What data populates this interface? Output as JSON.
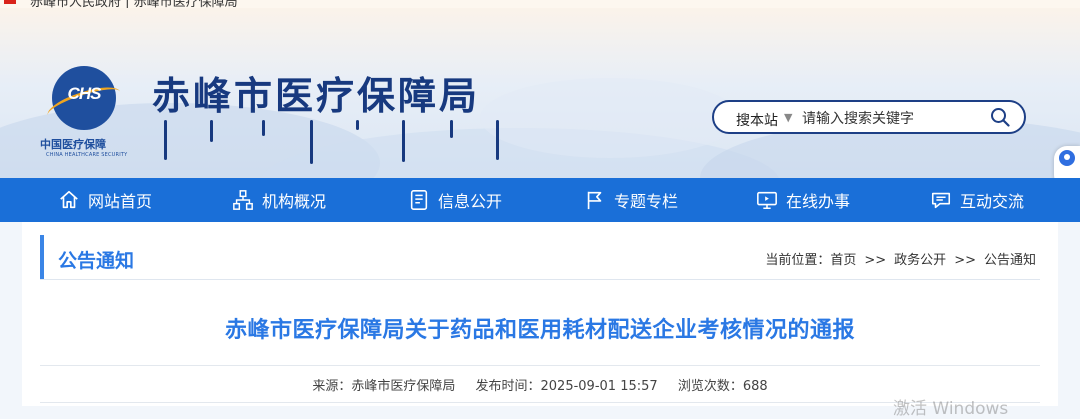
{
  "topbar": {
    "text": "赤峰市人民政府 | 赤峰市医疗保障局"
  },
  "header": {
    "logo": {
      "mark": "CHS",
      "cn": "中国医疗保障",
      "en": "CHINA HEALTHCARE SECURITY"
    },
    "site_title": "赤峰市医疗保障局",
    "search": {
      "scope": "搜本站",
      "placeholder": "请输入搜索关键字"
    }
  },
  "nav": {
    "items": [
      {
        "label": "网站首页",
        "icon": "home-icon"
      },
      {
        "label": "机构概况",
        "icon": "org-chart-icon"
      },
      {
        "label": "信息公开",
        "icon": "document-icon"
      },
      {
        "label": "专题专栏",
        "icon": "flag-icon"
      },
      {
        "label": "在线办事",
        "icon": "monitor-icon"
      },
      {
        "label": "互动交流",
        "icon": "chat-icon"
      }
    ]
  },
  "section": {
    "title": "公告通知"
  },
  "breadcrumb": {
    "prefix": "当前位置：",
    "sep": ">>",
    "items": [
      "首页",
      "政务公开",
      "公告通知"
    ]
  },
  "article": {
    "title": "赤峰市医疗保障局关于药品和医用耗材配送企业考核情况的通报",
    "source": "来源：赤峰市医疗保障局",
    "date": "发布时间：2025-09-01 15:57",
    "views": "浏览次数：688"
  },
  "os_watermark": "激活 Windows",
  "colors": {
    "nav_bg": "#1a6fd8",
    "accent": "#2a78e4",
    "brand": "#17397f"
  }
}
